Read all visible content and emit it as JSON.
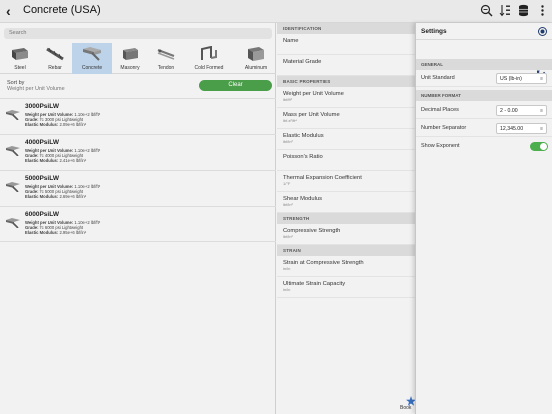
{
  "header": {
    "back_glyph": "‹",
    "title": "Concrete (USA)",
    "icons": [
      "search-zoom-icon",
      "sort-icon",
      "database-icon",
      "more-icon"
    ]
  },
  "search": {
    "placeholder": "Search"
  },
  "materials": [
    {
      "label": "Steel",
      "icon": "steel-icon",
      "selected": false
    },
    {
      "label": "Rebar",
      "icon": "rebar-icon",
      "selected": false
    },
    {
      "label": "Concrete",
      "icon": "concrete-icon",
      "selected": true
    },
    {
      "label": "Masonry",
      "icon": "masonry-icon",
      "selected": false
    },
    {
      "label": "Tendon",
      "icon": "tendon-icon",
      "selected": false
    },
    {
      "label": "Cold Formed",
      "icon": "cold-formed-icon",
      "selected": false
    },
    {
      "label": "Aluminum",
      "icon": "aluminum-icon",
      "selected": false
    }
  ],
  "sort": {
    "label": "Sort by",
    "value": "Weight per Unit Volume",
    "clear_label": "Clear"
  },
  "items": [
    {
      "name": "3000PsiLW",
      "l1k": "Weight per Unit Volume:",
      "l1v": " 1.10e+2 lbf/ft³",
      "l2k": "Grade:",
      "l2v": " f'c 3000 psi Lightweight",
      "l3k": "Elastic Modulus:",
      "l3v": " 2.09e+6 lbf/in²"
    },
    {
      "name": "4000PsiLW",
      "l1k": "Weight per Unit Volume:",
      "l1v": " 1.10e+2 lbf/ft³",
      "l2k": "Grade:",
      "l2v": " f'c 4000 psi Lightweight",
      "l3k": "Elastic Modulus:",
      "l3v": " 2.41e+6 lbf/in²"
    },
    {
      "name": "5000PsiLW",
      "l1k": "Weight per Unit Volume:",
      "l1v": " 1.10e+2 lbf/ft³",
      "l2k": "Grade:",
      "l2v": " f'c 5000 psi Lightweight",
      "l3k": "Elastic Modulus:",
      "l3v": " 2.69e+6 lbf/in²"
    },
    {
      "name": "6000PsiLW",
      "l1k": "Weight per Unit Volume:",
      "l1v": " 1.10e+2 lbf/ft³",
      "l2k": "Grade:",
      "l2v": " f'c 6000 psi Lightweight",
      "l3k": "Elastic Modulus:",
      "l3v": " 2.95e+6 lbf/in²"
    }
  ],
  "properties": {
    "identification": "IDENTIFICATION",
    "name": "Name",
    "material_grade": "Material Grade",
    "basic": "BASIC PROPERTIES",
    "weight": {
      "name": "Weight per Unit Volume",
      "unit": "lbf/ft³"
    },
    "mass": {
      "name": "Mass per Unit Volume",
      "unit": "lbf-s²/ft⁴"
    },
    "elastic": {
      "name": "Elastic Modulus",
      "unit": "lbf/in²"
    },
    "poisson": {
      "name": "Poisson's Ratio"
    },
    "thermal": {
      "name": "Thermal Expansion Coefficient",
      "unit": "1/°F"
    },
    "shear": {
      "name": "Shear Modulus",
      "unit": "lbf/in²"
    },
    "strength": "STRENGTH",
    "compressive": {
      "name": "Compressive Strength",
      "unit": "lbf/in²"
    },
    "strain": "STRAIN",
    "strain_compressive": {
      "name": "Strain at Compressive Strength",
      "unit": "in/in"
    },
    "ultimate": {
      "name": "Ultimate Strain Capacity",
      "unit": "in/in"
    }
  },
  "bookmark": {
    "label": "Book"
  },
  "settings": {
    "title": "Settings",
    "general": "GENERAL",
    "unit_standard_label": "Unit Standard",
    "unit_standard_value": "US (lb-in)",
    "number_format": "NUMBER FORMAT",
    "decimal_places_label": "Decimal Places",
    "decimal_places_value": "2 - 0.00",
    "number_separator_label": "Number Separator",
    "number_separator_value": "12,345.00",
    "show_exponent_label": "Show Exponent",
    "show_exponent": true,
    "menu_glyph": "≡"
  },
  "colors": {
    "accent": "#4a9d49",
    "selection": "#bcd3ea",
    "toggle_on": "#4cae4c"
  }
}
